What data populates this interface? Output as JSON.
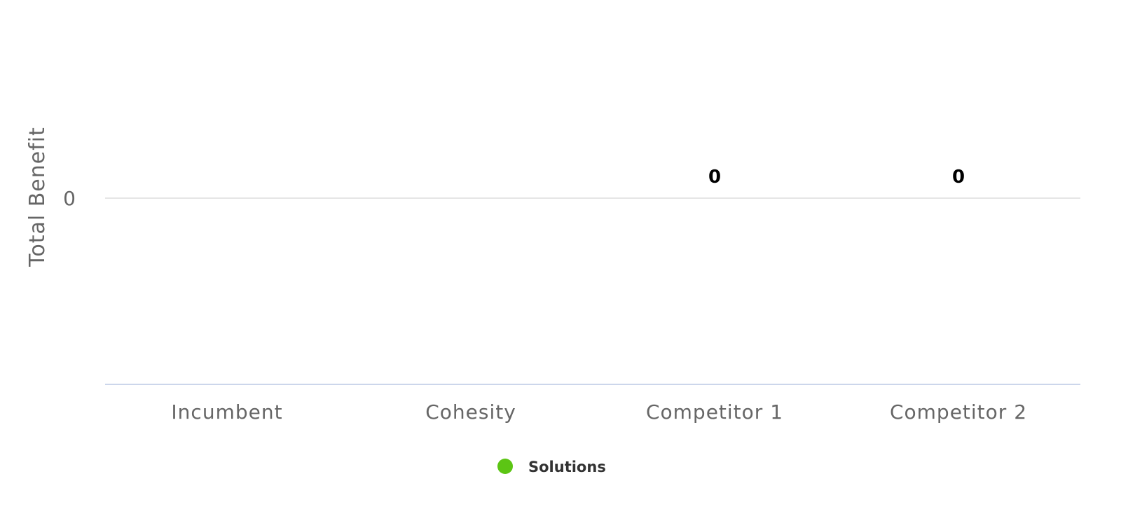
{
  "chart_data": {
    "type": "bar",
    "title": "",
    "xlabel": "",
    "ylabel": "Total Benefit",
    "categories": [
      "Incumbent",
      "Cohesity",
      "Competitor 1",
      "Competitor 2"
    ],
    "series": [
      {
        "name": "Solutions",
        "values": [
          null,
          null,
          0,
          0
        ],
        "data_labels": [
          "",
          "",
          "0",
          "0"
        ]
      }
    ],
    "y_ticks": [
      "0"
    ],
    "y_tick_values": [
      0
    ],
    "grid": true,
    "legend": "bottom-center",
    "colors": {
      "series": "#5cc514",
      "gridline": "#e6e6e6",
      "baseline": "#ccd6eb",
      "label": "#666666",
      "data_label": "#000000"
    }
  }
}
